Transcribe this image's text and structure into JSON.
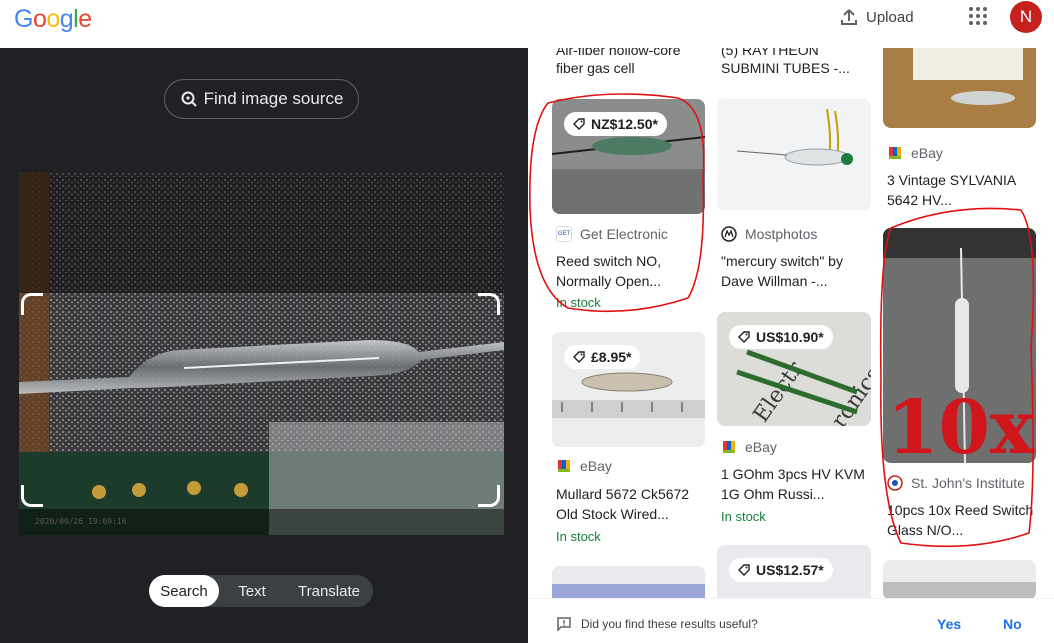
{
  "header": {
    "logo": "Google",
    "upload_label": "Upload",
    "avatar_initial": "N"
  },
  "lens": {
    "find_source_label": "Find image source",
    "photo_timestamp": "2020/09/26  19:09:16",
    "tabs": [
      "Search",
      "Text",
      "Translate"
    ],
    "active_tab": "Search"
  },
  "results": {
    "col1_top_title": "fiber gas cell",
    "col1_top_title_cut": "Air-fiber hollow-core",
    "col2_top_title_line1": "(5) RAYTHEON",
    "col2_top_title_line2": "SUBMINI TUBES -...",
    "items": [
      {
        "price": "NZ$12.50*",
        "source": "Get Electronic",
        "title": "Reed switch NO, Normally Open...",
        "stock": "In stock"
      },
      {
        "source": "Mostphotos",
        "title": "\"mercury switch\" by Dave Willman -..."
      },
      {
        "source": "eBay",
        "title": "3 Vintage SYLVANIA 5642 HV..."
      },
      {
        "price": "£8.95*",
        "source": "eBay",
        "title": "Mullard 5672 Ck5672 Old Stock Wired...",
        "stock": "In stock"
      },
      {
        "price": "US$10.90*",
        "source": "eBay",
        "title": "1 GOhm 3pcs HV KVM 1G Ohm Russi...",
        "stock": "In stock"
      },
      {
        "source": "St. John's Institute",
        "title": "10pcs 10x Reed Switch Glass N/O...",
        "overlay": "10x"
      },
      {
        "price": "US$12.57*"
      }
    ]
  },
  "feedback": {
    "question": "Did you find these results useful?",
    "yes": "Yes",
    "no": "No"
  },
  "colors": {
    "accent": "#1a73e8",
    "in_stock": "#188038",
    "annotation_red": "#e01010",
    "dark_pane": "#202124"
  }
}
